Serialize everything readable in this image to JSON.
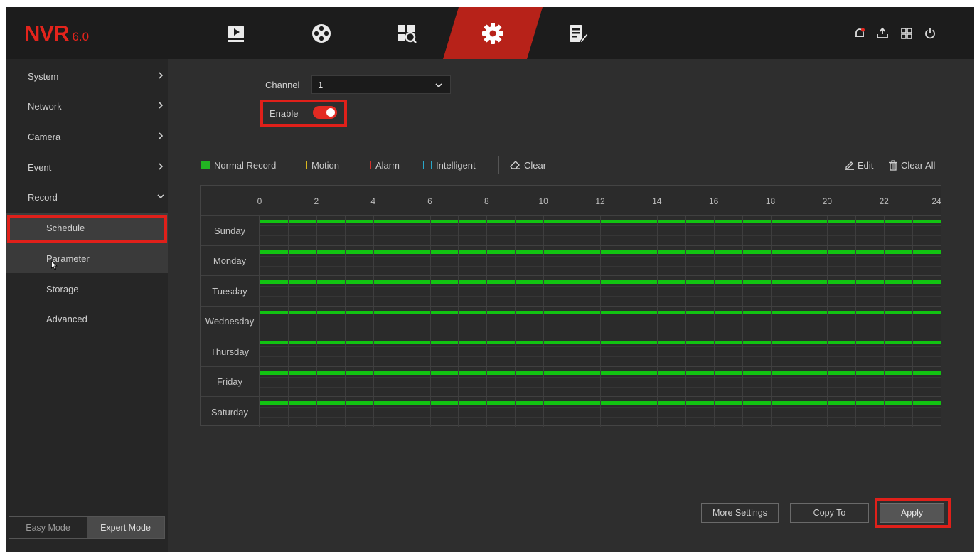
{
  "app": {
    "logo_text": "NVR",
    "logo_version": "6.0"
  },
  "topnav": [
    "playback-icon",
    "camera-reel-icon",
    "search-icon",
    "settings-gear-icon",
    "maintenance-icon"
  ],
  "toolbar_icons": [
    "alarm-bell-icon",
    "backup-icon",
    "layout-icon",
    "power-icon"
  ],
  "sidebar": {
    "items": [
      {
        "label": "System"
      },
      {
        "label": "Network"
      },
      {
        "label": "Camera"
      },
      {
        "label": "Event"
      },
      {
        "label": "Record"
      }
    ],
    "record_subitems": [
      {
        "label": "Schedule"
      },
      {
        "label": "Parameter"
      },
      {
        "label": "Storage"
      },
      {
        "label": "Advanced"
      }
    ],
    "mode": {
      "easy": "Easy Mode",
      "expert": "Expert Mode"
    }
  },
  "main": {
    "channel_label": "Channel",
    "channel_value": "1",
    "enable_label": "Enable",
    "enable_on": true,
    "legend": [
      {
        "label": "Normal Record",
        "color": "#22b522"
      },
      {
        "label": "Motion",
        "color": "#d8b71f"
      },
      {
        "label": "Alarm",
        "color": "#d4302a"
      },
      {
        "label": "Intelligent",
        "color": "#2aa7c9"
      }
    ],
    "clear_label": "Clear",
    "edit_label": "Edit",
    "clear_all_label": "Clear All",
    "hour_ticks": [
      "0",
      "2",
      "4",
      "6",
      "8",
      "10",
      "12",
      "14",
      "16",
      "18",
      "20",
      "22",
      "24"
    ],
    "days": [
      "Sunday",
      "Monday",
      "Tuesday",
      "Wednesday",
      "Thursday",
      "Friday",
      "Saturday"
    ],
    "record_color": "#12c312"
  },
  "buttons": {
    "more_settings": "More Settings",
    "copy_to": "Copy To",
    "apply": "Apply"
  }
}
